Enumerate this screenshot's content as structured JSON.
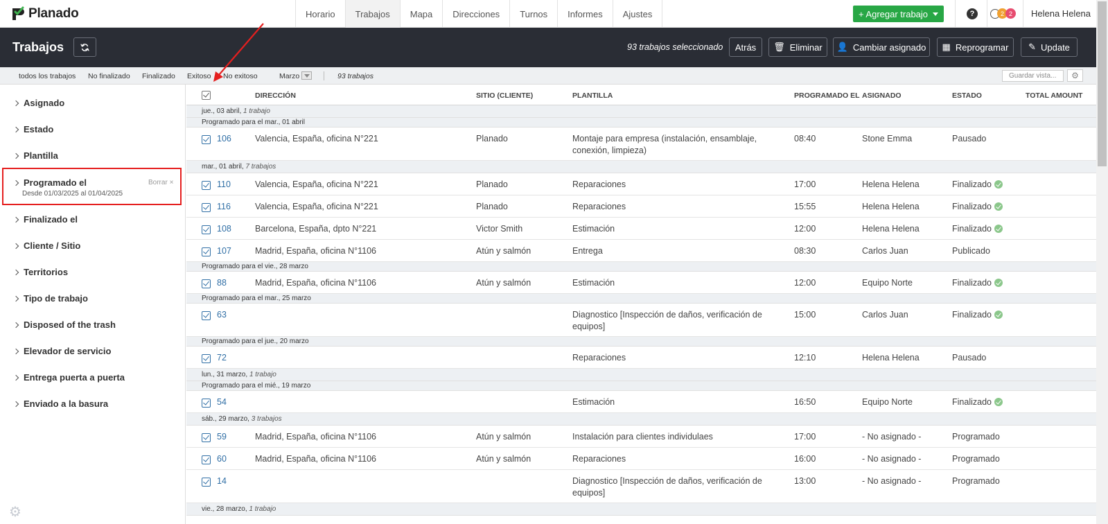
{
  "app": {
    "name": "Planado",
    "user": "Helena Helena"
  },
  "nav": {
    "tabs": [
      "Horario",
      "Trabajos",
      "Mapa",
      "Direcciones",
      "Turnos",
      "Informes",
      "Ajustes"
    ],
    "active": "Trabajos"
  },
  "add_button": "+ Agregar trabajo",
  "help_label": "?",
  "notifications": {
    "count1": "2",
    "count2": "2"
  },
  "header": {
    "title": "Trabajos",
    "selected_text": "93 trabajos seleccionado",
    "buttons": {
      "back": "Atrás",
      "delete": "Eliminar",
      "change_assigned": "Cambiar asignado",
      "reschedule": "Reprogramar",
      "update": "Update"
    }
  },
  "filters": {
    "items": [
      "todos los trabajos",
      "No finalizado",
      "Finalizado",
      "Exitoso",
      "No exitoso",
      "Marzo"
    ],
    "count": "93 trabajos",
    "save_view_placeholder": "Guardar vista..."
  },
  "sidebar": {
    "items": [
      "Asignado",
      "Estado",
      "Plantilla",
      "Programado el",
      "Finalizado el",
      "Cliente / Sitio",
      "Territorios",
      "Tipo de trabajo",
      "Disposed of the trash",
      "Elevador de servicio",
      "Entrega puerta a puerta",
      "Enviado a la basura"
    ],
    "programado_sub": "Desde 01/03/2025 al 01/04/2025",
    "clear": "Borrar"
  },
  "table": {
    "columns": [
      "DIRECCIÓN",
      "SITIO (CLIENTE)",
      "PLANTILLA",
      "PROGRAMADO EL",
      "ASIGNADO",
      "ESTADO",
      "TOTAL AMOUNT"
    ],
    "groups": [
      {
        "date": "jue., 03 abril",
        "count": "1 trabajo"
      },
      {
        "date": "mar., 01 abril",
        "count": "7 trabajos"
      },
      {
        "date": "lun., 31 marzo",
        "count": "1 trabajo"
      },
      {
        "date": "sáb., 29 marzo",
        "count": "3 trabajos"
      },
      {
        "date": "vie., 28 marzo",
        "count": "1 trabajo"
      }
    ],
    "subgroups": [
      "Programado para el mar., 01 abril",
      "Programado para el vie., 28 marzo",
      "Programado para el mar., 25 marzo",
      "Programado para el jue., 20 marzo",
      "Programado para el mié., 19 marzo"
    ],
    "rows": [
      {
        "id": "106",
        "address": "Valencia, España, oficina N°221",
        "site": "Planado",
        "template1": "Montaje para empresa (instalación, ensamblaje,",
        "template2": "conexión, limpieza)",
        "time": "08:40",
        "assigned": "Stone Emma",
        "status": "Pausado"
      },
      {
        "id": "110",
        "address": "Valencia, España, oficina N°221",
        "site": "Planado",
        "template1": "Reparaciones",
        "template2": "",
        "time": "17:00",
        "assigned": "Helena Helena",
        "status": "Finalizado"
      },
      {
        "id": "116",
        "address": "Valencia, España, oficina N°221",
        "site": "Planado",
        "template1": "Reparaciones",
        "template2": "",
        "time": "15:55",
        "assigned": "Helena Helena",
        "status": "Finalizado"
      },
      {
        "id": "108",
        "address": "Barcelona, España, dpto N°221",
        "site": "Victor Smith",
        "template1": "Estimación",
        "template2": "",
        "time": "12:00",
        "assigned": "Helena Helena",
        "status": "Finalizado"
      },
      {
        "id": "107",
        "address": "Madrid, España, oficina N°1106",
        "site": "Atún y salmón",
        "template1": "Entrega",
        "template2": "",
        "time": "08:30",
        "assigned": "Carlos Juan",
        "status": "Publicado"
      },
      {
        "id": "88",
        "address": "Madrid, España, oficina N°1106",
        "site": "Atún y salmón",
        "template1": "Estimación",
        "template2": "",
        "time": "12:00",
        "assigned": "Equipo Norte",
        "status": "Finalizado"
      },
      {
        "id": "63",
        "address": "",
        "site": "",
        "template1": "Diagnostico [Inspección de daños, verificación de",
        "template2": "equipos]",
        "time": "15:00",
        "assigned": "Carlos Juan",
        "status": "Finalizado"
      },
      {
        "id": "72",
        "address": "",
        "site": "",
        "template1": "Reparaciones",
        "template2": "",
        "time": "12:10",
        "assigned": "Helena Helena",
        "status": "Pausado"
      },
      {
        "id": "54",
        "address": "",
        "site": "",
        "template1": "Estimación",
        "template2": "",
        "time": "16:50",
        "assigned": "Equipo Norte",
        "status": "Finalizado"
      },
      {
        "id": "59",
        "address": "Madrid, España, oficina N°1106",
        "site": "Atún y salmón",
        "template1": "Instalación para clientes individulaes",
        "template2": "",
        "time": "17:00",
        "assigned": "- No asignado -",
        "status": "Programado"
      },
      {
        "id": "60",
        "address": "Madrid, España, oficina N°1106",
        "site": "Atún y salmón",
        "template1": "Reparaciones",
        "template2": "",
        "time": "16:00",
        "assigned": "- No asignado -",
        "status": "Programado"
      },
      {
        "id": "14",
        "address": "",
        "site": "",
        "template1": "Diagnostico [Inspección de daños, verificación de",
        "template2": "equipos]",
        "time": "13:00",
        "assigned": "- No asignado -",
        "status": "Programado"
      }
    ]
  },
  "colors": {
    "accent": "#28a745",
    "link": "#2f6ea5",
    "header": "#2a2d35",
    "highlight": "#e51f1f"
  }
}
